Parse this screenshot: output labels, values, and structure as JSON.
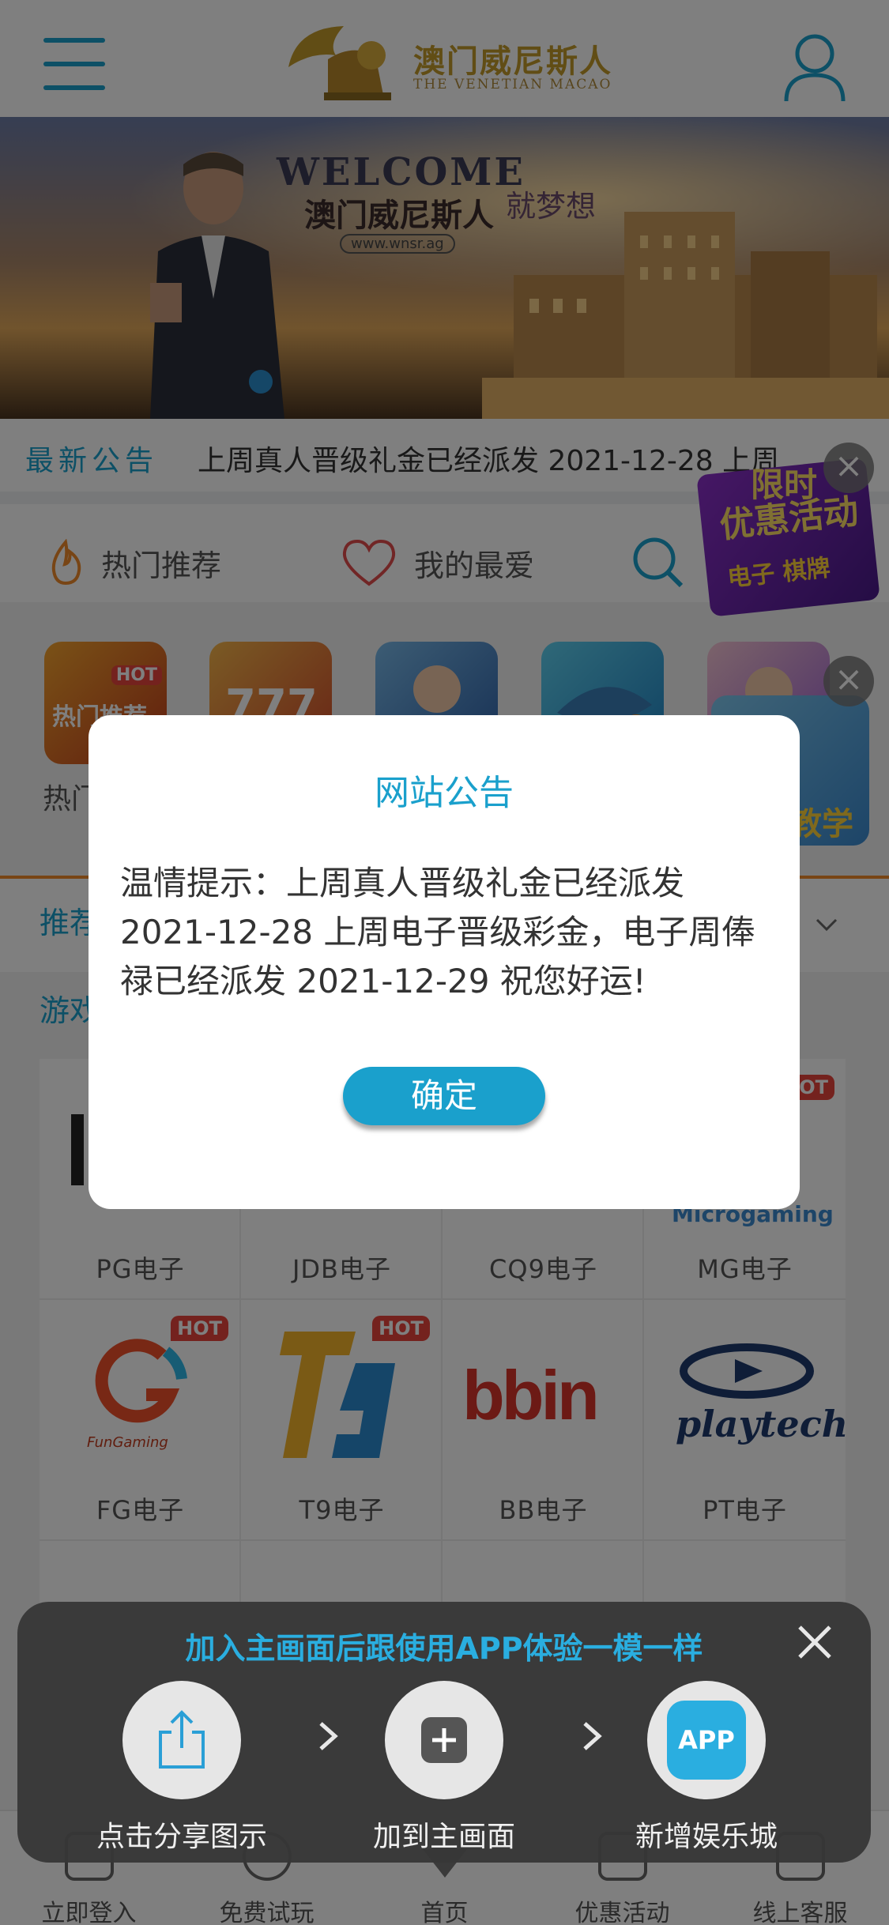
{
  "header": {
    "logo_cn": "澳门威尼斯人",
    "logo_en": "THE VENETIAN MACAO"
  },
  "banner": {
    "welcome": "WELCOME",
    "title_cn": "澳门威尼斯人",
    "title_cn2": "就梦想",
    "url": "www.wnsr.ag"
  },
  "notice": {
    "label": "最新公告",
    "text": "上周真人晋级礼金已经派发 2021-12-28 上周"
  },
  "tabs": [
    {
      "label": "热门推荐"
    },
    {
      "label": "我的最爱"
    }
  ],
  "hot_games": {
    "label_partial": "热门",
    "badge": "HOT",
    "card_text": "热门推荐"
  },
  "float_promo": {
    "line1": "优惠活动",
    "line2": "电子 棋牌",
    "top": "限时",
    "teach": "教学"
  },
  "recommend": {
    "label": "推荐"
  },
  "games_section": {
    "label": "游戏"
  },
  "game_grid": [
    {
      "label": "PG电子",
      "hot": false
    },
    {
      "label": "JDB电子",
      "hot": false
    },
    {
      "label": "CQ9电子",
      "hot": false
    },
    {
      "label": "MG电子",
      "hot": true,
      "logo": "Microgaming"
    },
    {
      "label": "FG电子",
      "hot": true,
      "logo": "FunGaming"
    },
    {
      "label": "T9电子",
      "hot": true,
      "logo": "T9"
    },
    {
      "label": "BB电子",
      "hot": false,
      "logo": "bbin"
    },
    {
      "label": "PT电子",
      "hot": false,
      "logo": "playtech"
    }
  ],
  "bottom_nav": [
    {
      "label": "立即登入"
    },
    {
      "label": "免费试玩"
    },
    {
      "label": "首页"
    },
    {
      "label": "优惠活动"
    },
    {
      "label": "线上客服"
    }
  ],
  "modal": {
    "title": "网站公告",
    "body": "温情提示：上周真人晋级礼金已经派发 2021-12-28 上周电子晋级彩金，电子周俸禄已经派发 2021-12-29  祝您好运!",
    "confirm": "确定"
  },
  "add_to_home": {
    "title": "加入主画面后跟使用APP体验一模一样",
    "steps": [
      {
        "label": "点击分享图示",
        "icon": "share-icon"
      },
      {
        "label": "加到主画面",
        "icon": "add-square-icon"
      },
      {
        "label": "新增娱乐城",
        "icon": "app-icon",
        "icon_text": "APP"
      }
    ]
  },
  "colors": {
    "accent": "#1aa0cc",
    "hot": "#e8453c",
    "divider": "#f08b2a"
  }
}
